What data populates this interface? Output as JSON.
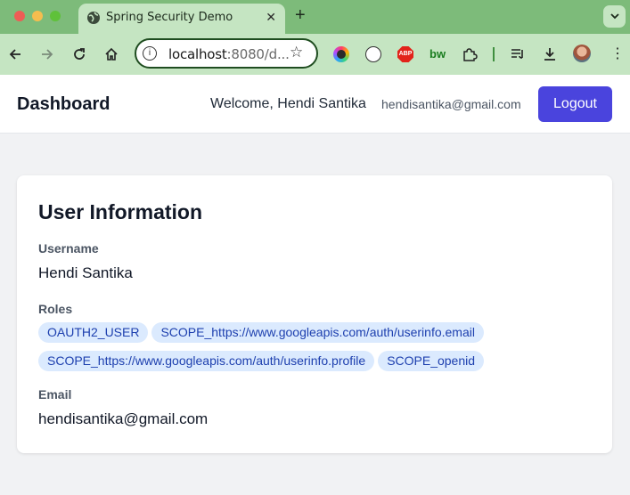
{
  "browser": {
    "tab_title": "Spring Security Demo",
    "url_host": "localhost",
    "url_rest": ":8080/d...",
    "tab_close_glyph": "✕",
    "new_tab_glyph": "+",
    "extension_bw": "bw",
    "extension_abp": "ABP"
  },
  "header": {
    "title": "Dashboard",
    "welcome": "Welcome, Hendi Santika",
    "email": "hendisantika@gmail.com",
    "logout_label": "Logout"
  },
  "user_info": {
    "title": "User Information",
    "username_label": "Username",
    "username": "Hendi Santika",
    "roles_label": "Roles",
    "roles": [
      "OAUTH2_USER",
      "SCOPE_https://www.googleapis.com/auth/userinfo.email",
      "SCOPE_https://www.googleapis.com/auth/userinfo.profile",
      "SCOPE_openid"
    ],
    "email_label": "Email",
    "email": "hendisantika@gmail.com"
  },
  "colors": {
    "tab_strip": "#7dbb7a",
    "toolbar": "#c5e5c2",
    "logout_button": "#4a44dd",
    "role_badge_bg": "#dbeafe",
    "role_badge_text": "#1e40af"
  }
}
